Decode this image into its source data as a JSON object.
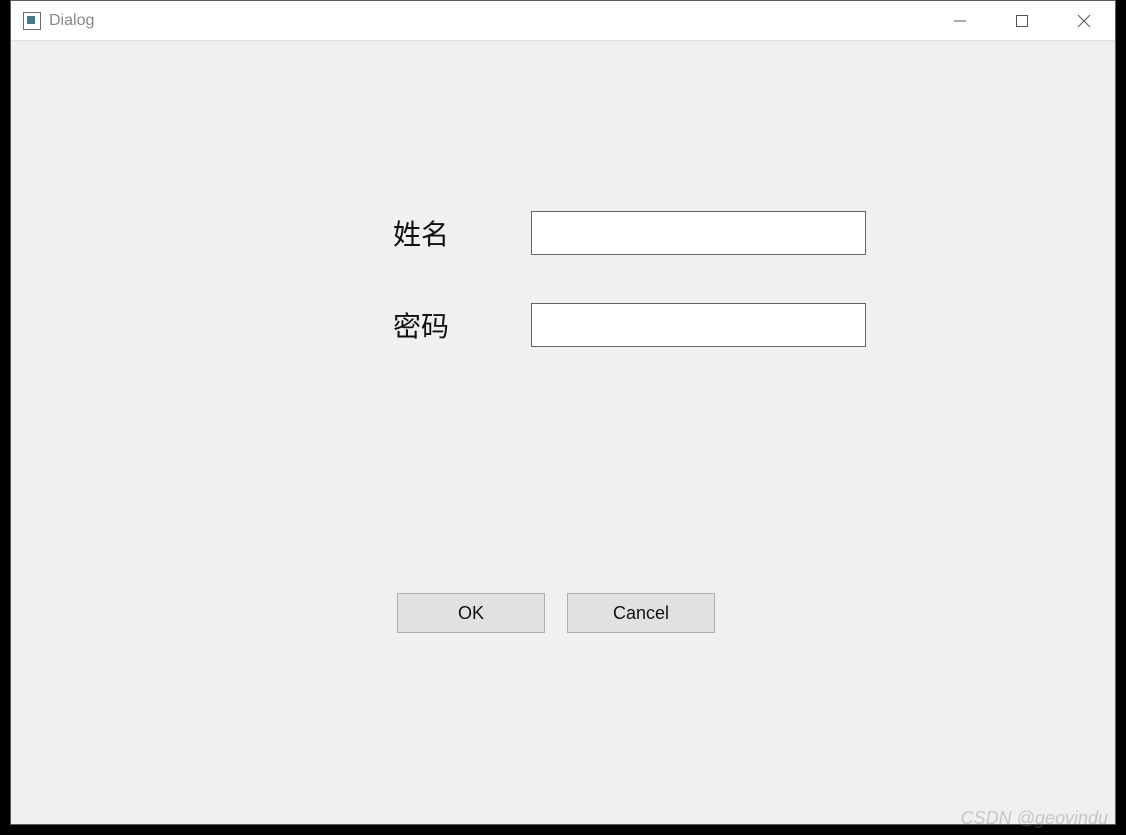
{
  "window": {
    "title": "Dialog"
  },
  "form": {
    "name": {
      "label": "姓名",
      "value": ""
    },
    "password": {
      "label": "密码",
      "value": ""
    }
  },
  "buttons": {
    "ok": "OK",
    "cancel": "Cancel"
  },
  "watermark": "CSDN @geovindu"
}
